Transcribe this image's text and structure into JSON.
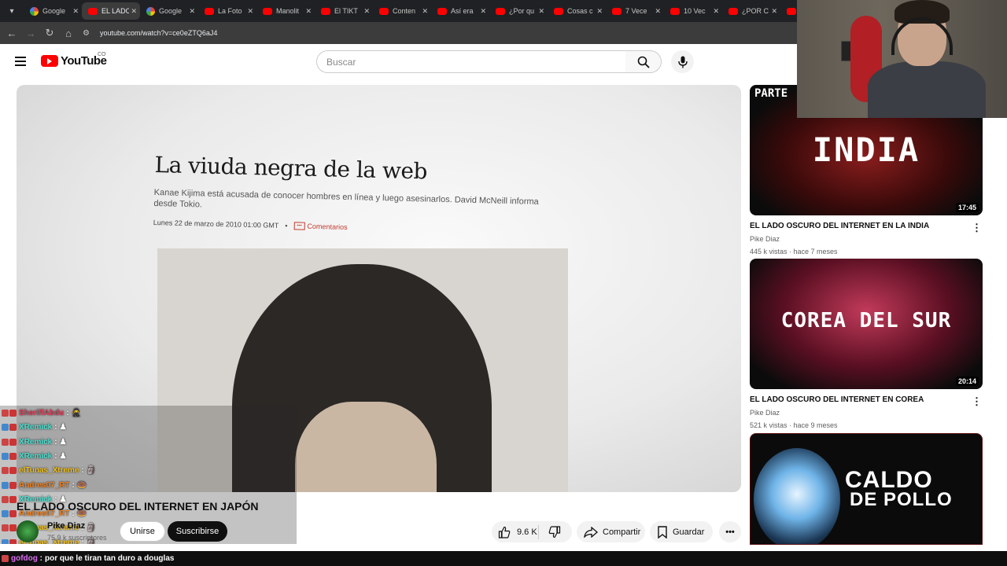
{
  "browser": {
    "tabs": [
      {
        "label": "Google",
        "favicon": "google",
        "active": false
      },
      {
        "label": "EL LADO",
        "favicon": "youtube",
        "active": true
      },
      {
        "label": "Google",
        "favicon": "google",
        "active": false
      },
      {
        "label": "La Foto",
        "favicon": "youtube",
        "active": false
      },
      {
        "label": "Manolit",
        "favicon": "youtube",
        "active": false
      },
      {
        "label": "El TIKT",
        "favicon": "youtube",
        "active": false
      },
      {
        "label": "Conten",
        "favicon": "youtube",
        "active": false
      },
      {
        "label": "Así era",
        "favicon": "youtube",
        "active": false
      },
      {
        "label": "¿Por qu",
        "favicon": "youtube",
        "active": false
      },
      {
        "label": "Cosas c",
        "favicon": "youtube",
        "active": false
      },
      {
        "label": "7 Vece",
        "favicon": "youtube",
        "active": false
      },
      {
        "label": "10 Vec",
        "favicon": "youtube",
        "active": false
      },
      {
        "label": "¿POR C",
        "favicon": "youtube",
        "active": false
      },
      {
        "label": "R",
        "favicon": "youtube",
        "active": false
      }
    ],
    "url": "youtube.com/watch?v=ce0eZTQ6aJ4"
  },
  "youtube": {
    "logo_text": "YouTube",
    "country_code": "CO",
    "search_placeholder": "Buscar"
  },
  "video": {
    "frame": {
      "headline": "La viuda negra de la web",
      "deck": "Kanae Kijima está acusada de conocer hombres en línea y luego asesinarlos. David McNeill informa desde Tokio.",
      "dateline": "Lunes 22 de marzo de 2010 01:00 GMT",
      "comments_label": "Comentarios"
    },
    "title": "EL LADO OSCURO DEL INTERNET EN JAPÓN",
    "channel": "Pike Diaz",
    "subscribers": "75,9 k suscriptores",
    "join_label": "Unirse",
    "subscribe_label": "Suscribirse",
    "likes": "9.6 K",
    "share_label": "Compartir",
    "save_label": "Guardar"
  },
  "recommendations": [
    {
      "thumb_top": "PARTE",
      "thumb_text": "INDIA",
      "duration": "17:45",
      "title": "EL LADO OSCURO DEL INTERNET EN LA INDIA",
      "channel": "Pike Diaz",
      "stats": "445 k vistas · hace 7 meses"
    },
    {
      "thumb_text": "COREA DEL SUR",
      "duration": "20:14",
      "title": "EL LADO OSCURO DEL INTERNET EN COREA",
      "channel": "Pike Diaz",
      "stats": "521 k vistas · hace 9 meses"
    },
    {
      "thumb_text_1": "CALDO",
      "thumb_text_2": "DE POLLO"
    }
  ],
  "stream_chat": [
    {
      "user": "SheriffAbdu",
      "color": "#e0405a",
      "emote": "🥷"
    },
    {
      "user": "XRemick",
      "color": "#4be0d0",
      "emote": "♟"
    },
    {
      "user": "XRemick",
      "color": "#4be0d0",
      "emote": "♟"
    },
    {
      "user": "XRemick",
      "color": "#4be0d0",
      "emote": "♟"
    },
    {
      "user": "elTunas_Xtreme",
      "color": "#f0c020",
      "emote": "🗿"
    },
    {
      "user": "Andres07_RT",
      "color": "#f08020",
      "emote": "🍩"
    },
    {
      "user": "XRemick",
      "color": "#4be0d0",
      "emote": "♟"
    },
    {
      "user": "Andres07_RT",
      "color": "#f08020",
      "emote": "🍩"
    },
    {
      "user": "elTunas_Xtreme",
      "color": "#f0c020",
      "emote": "🗿"
    },
    {
      "user": "elTunas_Xtreme",
      "color": "#f0c020",
      "emote": "🗿"
    }
  ],
  "bottom_chat": {
    "user": "gofdog",
    "message": "por que le tiran tan duro a douglas"
  }
}
